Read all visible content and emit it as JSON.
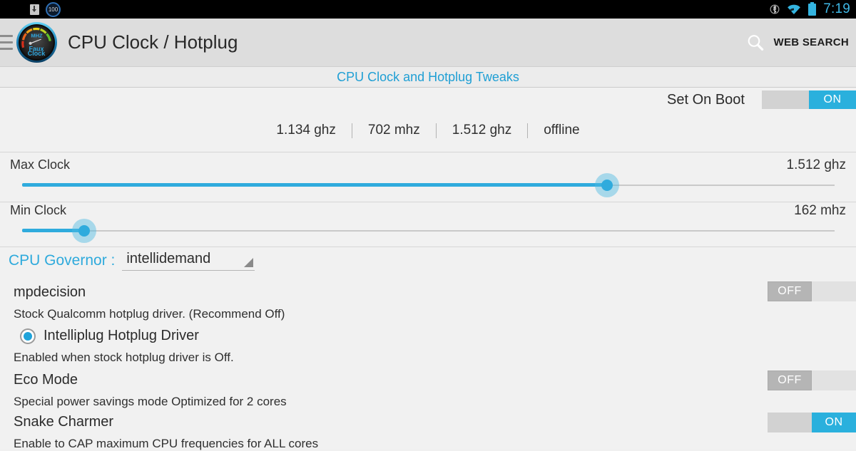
{
  "statusbar": {
    "icons_left": [
      "download-icon",
      "battery-100-badge-icon"
    ],
    "battery_badge": "100",
    "icons_right": [
      "bluetooth-icon",
      "wifi-icon",
      "battery-icon"
    ],
    "clock": "7:19"
  },
  "actionbar": {
    "menu_icon": "hamburger-menu-icon",
    "app_icon": "fauxclock-gauge-icon",
    "app_icon_text": {
      "unit": "MHZ",
      "brand_top": "Faux",
      "brand_bottom": "Clock"
    },
    "title": "CPU Clock / Hotplug",
    "search_icon": "search-icon",
    "search_label": "WEB SEARCH"
  },
  "subtitle": "CPU Clock and Hotplug Tweaks",
  "set_on_boot": {
    "label": "Set On Boot",
    "state": "ON"
  },
  "cpu_cores": [
    {
      "value": "1.134 ghz"
    },
    {
      "value": "702 mhz"
    },
    {
      "value": "1.512 ghz"
    },
    {
      "value": "offline"
    }
  ],
  "sliders": [
    {
      "name": "Max Clock",
      "value": "1.512 ghz",
      "fill_percent": 72,
      "thumb_percent": 72
    },
    {
      "name": "Min Clock",
      "value": "162 mhz",
      "fill_percent": 7.6,
      "thumb_percent": 7.6
    }
  ],
  "governor": {
    "label": "CPU Governor :",
    "selected": "intellidemand",
    "dropdown_icon": "dropdown-triangle-icon"
  },
  "settings": [
    {
      "title": "mpdecision",
      "description": "Stock Qualcomm hotplug driver. (Recommend Off)",
      "control": "toggle",
      "state": "OFF"
    },
    {
      "title": "Intelliplug Hotplug Driver",
      "description": "Enabled when stock hotplug driver is Off.",
      "control": "radio",
      "state": "checked"
    },
    {
      "title": "Eco Mode",
      "description": "Special power savings mode Optimized for 2 cores",
      "control": "toggle",
      "state": "OFF"
    },
    {
      "title": "Snake Charmer",
      "description": "Enable to CAP maximum CPU frequencies for ALL cores",
      "control": "toggle",
      "state": "ON"
    }
  ],
  "colors": {
    "accent": "#2fabdd",
    "accent_text": "#1f9fd4",
    "statusbar_bg": "#000000",
    "actionbar_bg": "#dddddd",
    "page_bg": "#f1f1f1",
    "toggle_off": "#b5b5b5"
  }
}
